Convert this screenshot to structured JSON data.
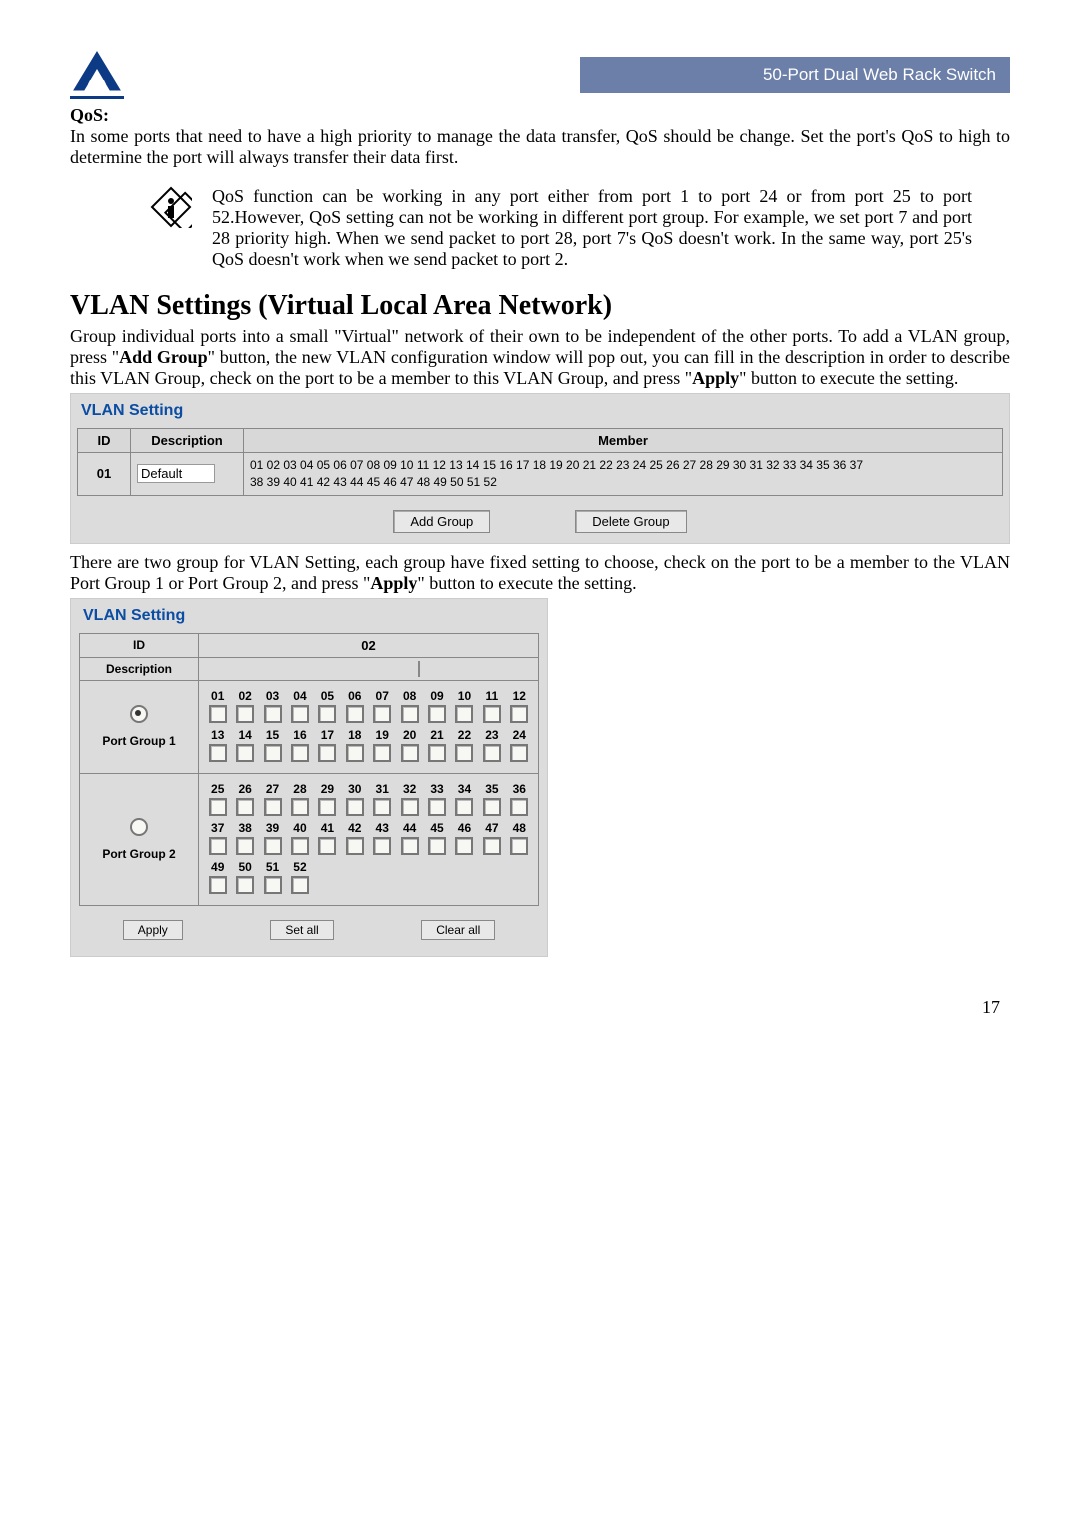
{
  "header": {
    "title_bar": "50-Port Dual Web Rack Switch"
  },
  "qos": {
    "heading": "QoS:",
    "para": "In some ports that need to have a high priority to manage the data transfer, QoS should be change. Set the port's QoS to high to determine the port will always transfer their data first.",
    "note": "QoS function can be working in any port either from port 1 to port 24 or from port 25 to port 52.However, QoS setting can not be working in different port group. For example, we set port 7 and port 28 priority high. When we send packet to port 28, port 7's QoS doesn't work. In the same way, port 25's QoS doesn't work when we send packet to port 2."
  },
  "vlan": {
    "heading": "VLAN Settings (Virtual Local Area Network)",
    "para1_a": "Group individual ports into a small \"Virtual\" network of their own to be independent of the other ports. To add a VLAN group, press \"",
    "para1_b": "Add Group",
    "para1_c": "\" button, the new VLAN configuration window will pop out, you can fill in the description in order to describe this VLAN Group, check on the port to be a member to this VLAN Group, and press \"",
    "para1_d": "Apply",
    "para1_e": "\" button to execute the setting.",
    "box1": {
      "title": "VLAN Setting",
      "cols": {
        "id": "ID",
        "desc": "Description",
        "member": "Member"
      },
      "row": {
        "id": "01",
        "desc": "Default",
        "member_line1": "01 02 03 04 05 06 07 08 09 10 11 12 13 14 15 16 17 18 19 20 21 22 23 24 25 26 27 28 29 30 31 32 33 34 35 36 37",
        "member_line2": "38 39 40 41 42 43 44 45 46 47 48 49 50 51 52"
      },
      "btn_add": "Add Group",
      "btn_del": "Delete Group"
    },
    "para2_a": "There are two group for VLAN Setting, each group have fixed setting to choose, check on the port to be a member to the VLAN Port Group 1 or Port Group 2, and press \"",
    "para2_b": "Apply",
    "para2_c": "\" button to execute the setting.",
    "box2": {
      "title": "VLAN Setting",
      "id_label": "ID",
      "id_value": "02",
      "desc_label": "Description",
      "group1_label": "Port Group 1",
      "group2_label": "Port Group 2",
      "g1_row1": [
        "01",
        "02",
        "03",
        "04",
        "05",
        "06",
        "07",
        "08",
        "09",
        "10",
        "11",
        "12"
      ],
      "g1_row2": [
        "13",
        "14",
        "15",
        "16",
        "17",
        "18",
        "19",
        "20",
        "21",
        "22",
        "23",
        "24"
      ],
      "g2_row1": [
        "25",
        "26",
        "27",
        "28",
        "29",
        "30",
        "31",
        "32",
        "33",
        "34",
        "35",
        "36"
      ],
      "g2_row2": [
        "37",
        "38",
        "39",
        "40",
        "41",
        "42",
        "43",
        "44",
        "45",
        "46",
        "47",
        "48"
      ],
      "g2_row3": [
        "49",
        "50",
        "51",
        "52"
      ],
      "btn_apply": "Apply",
      "btn_setall": "Set all",
      "btn_clearall": "Clear all"
    }
  },
  "page_number": "17"
}
